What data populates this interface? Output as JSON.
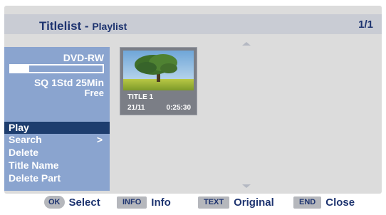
{
  "header": {
    "title_main": "Titlelist",
    "title_separator": " - ",
    "title_sub": "Playlist",
    "page_indicator": "1/1"
  },
  "disc_info": {
    "disc_type": "DVD-RW",
    "capacity_used_fraction": 0.2,
    "record_mode_remaining": "SQ 1Std 25Min",
    "free_label": "Free"
  },
  "menu": {
    "items": [
      {
        "label": "Play",
        "selected": true
      },
      {
        "label": "Search",
        "submenu_marker": ">"
      },
      {
        "label": "Delete"
      },
      {
        "label": "Title Name"
      },
      {
        "label": "Delete Part"
      }
    ]
  },
  "titles": [
    {
      "name": "TITLE 1",
      "date": "21/11",
      "duration": "0:25:30",
      "thumbnail_icon": "tree-landscape-thumbnail"
    }
  ],
  "footer": {
    "select": {
      "key": "OK",
      "label": "Select"
    },
    "info": {
      "key": "INFO",
      "label": "Info"
    },
    "original": {
      "key": "TEXT",
      "label": "Original"
    },
    "close": {
      "key": "END",
      "label": "Close"
    }
  },
  "colors": {
    "accent_text": "#1e3470",
    "panel_blue": "#8aa4cf",
    "selected_item": "#1d3d6e",
    "background_gray": "#dcdcdc"
  }
}
